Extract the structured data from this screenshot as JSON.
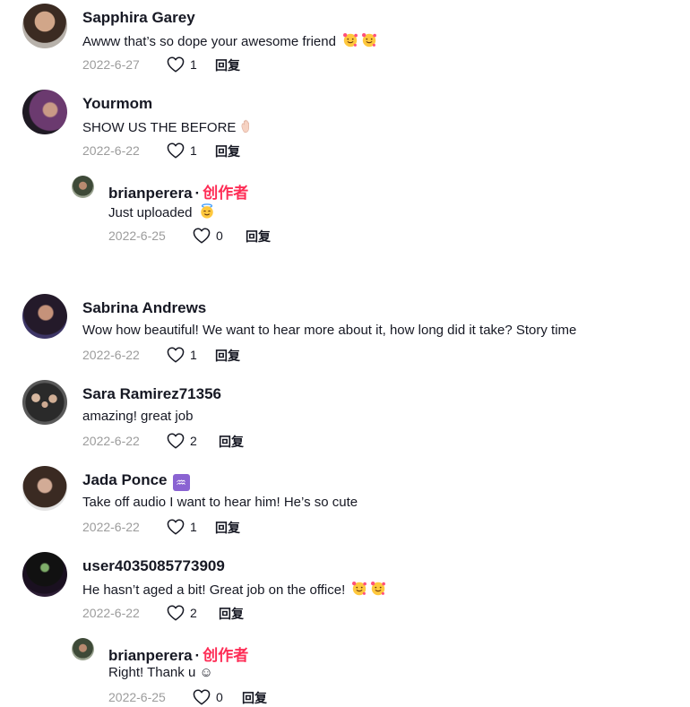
{
  "reply_label": "回复",
  "creator_label": "创作者",
  "comments": [
    {
      "name": "Sapphira Garey",
      "text": "Awww that’s so dope your awesome friend",
      "date": "2022-6-27",
      "likes": "1",
      "emoji_count": 2
    },
    {
      "name": "Yourmom",
      "text": "SHOW US THE BEFORE",
      "date": "2022-6-22",
      "likes": "1"
    },
    {
      "name": "brianperera",
      "text": "Just uploaded",
      "date": "2022-6-25",
      "likes": "0"
    },
    {
      "name": "Sabrina Andrews",
      "text": "Wow how beautiful! We want to hear more about it, how long did it take? Story time",
      "date": "2022-6-22",
      "likes": "1"
    },
    {
      "name": "Sara Ramirez71356",
      "text": "amazing! great job",
      "date": "2022-6-22",
      "likes": "2"
    },
    {
      "name": "Jada Ponce",
      "text": "Take off audio I want to hear him! He’s so cute",
      "date": "2022-6-22",
      "likes": "1",
      "badge": "♒"
    },
    {
      "name": "user4035085773909",
      "text": "He hasn’t aged a bit! Great job on the office!",
      "date": "2022-6-22",
      "likes": "2"
    },
    {
      "name": "brianperera",
      "text": "Right! Thank u ☺",
      "date": "2022-6-25",
      "likes": "0"
    }
  ]
}
